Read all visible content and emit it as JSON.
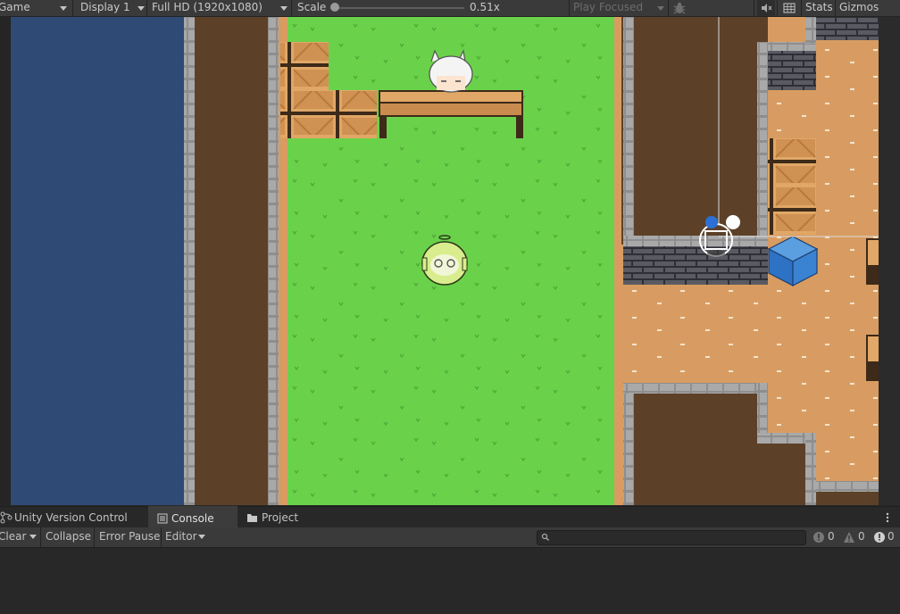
{
  "toolbar": {
    "view_dropdown": "Game",
    "display_dropdown": "Display 1",
    "resolution_dropdown": "Full HD (1920x1080)",
    "scale_label": "Scale",
    "scale_value": "0.51x",
    "play_mode_dropdown": "Play Focused",
    "stats_button": "Stats",
    "gizmos_button": "Gizmos"
  },
  "panel_tabs": {
    "version_control": "Unity Version Control",
    "console": "Console",
    "project": "Project"
  },
  "console_toolbar": {
    "clear": "Clear",
    "collapse": "Collapse",
    "error_pause": "Error Pause",
    "editor": "Editor",
    "search_placeholder": "",
    "info_count": "0",
    "warning_count": "0",
    "error_count": "0"
  },
  "colors": {
    "editor_bg": "#282828",
    "toolbar_bg": "#3a3a3a",
    "water": "#2f4a74",
    "dirt": "#5c4128",
    "grass": "#6ad24a",
    "sand": "#d89c62",
    "stone": "#9a9a9a"
  },
  "icons": [
    "caret-down-icon",
    "bug-icon",
    "mute-icon",
    "grid-icon",
    "cube-icon",
    "info-icon",
    "warning-icon",
    "error-icon",
    "search-icon",
    "menu-icon",
    "folder-icon",
    "branch-icon",
    "console-icon"
  ]
}
